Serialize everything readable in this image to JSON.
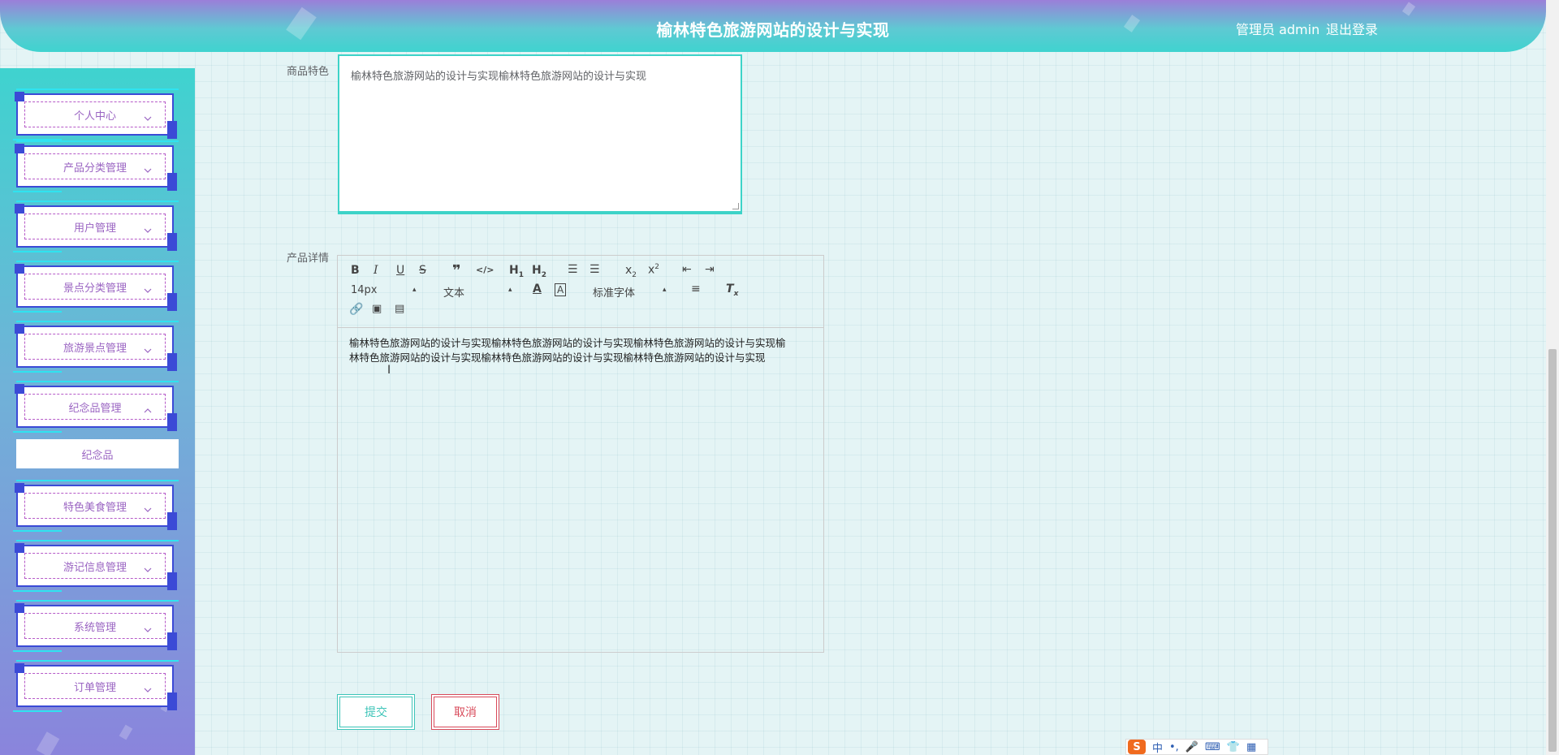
{
  "header": {
    "title": "榆林特色旅游网站的设计与实现",
    "user": "管理员 admin",
    "logout": "退出登录"
  },
  "sidebar": {
    "items": [
      {
        "label": "个人中心",
        "expanded": false
      },
      {
        "label": "产品分类管理",
        "expanded": false
      },
      {
        "label": "用户管理",
        "expanded": false
      },
      {
        "label": "景点分类管理",
        "expanded": false
      },
      {
        "label": "旅游景点管理",
        "expanded": false
      },
      {
        "label": "纪念品管理",
        "expanded": true
      },
      {
        "label": "特色美食管理",
        "expanded": false
      },
      {
        "label": "游记信息管理",
        "expanded": false
      },
      {
        "label": "系统管理",
        "expanded": false
      },
      {
        "label": "订单管理",
        "expanded": false
      }
    ],
    "sub_item": "纪念品"
  },
  "form": {
    "feature_label": "商品特色",
    "feature_value": "榆林特色旅游网站的设计与实现榆林特色旅游网站的设计与实现",
    "detail_label": "产品详情",
    "editor": {
      "font_size": "14px",
      "header_select": "文本",
      "font_family": "标准字体",
      "content_line1": "榆林特色旅游网站的设计与实现榆林特色旅游网站的设计与实现榆林特色旅游网站的设计与实现榆",
      "content_line2": "林特色旅游网站的设计与实现榆林特色旅游网站的设计与实现榆林特色旅游网站的设计与实现"
    },
    "submit_label": "提交",
    "cancel_label": "取消"
  },
  "ime": {
    "logo": "S",
    "mode": "中"
  },
  "colors": {
    "accent": "#3dd3c8",
    "cancel": "#d84a5a",
    "menu_text": "#9a64c2",
    "frame": "#3b4ad6"
  }
}
